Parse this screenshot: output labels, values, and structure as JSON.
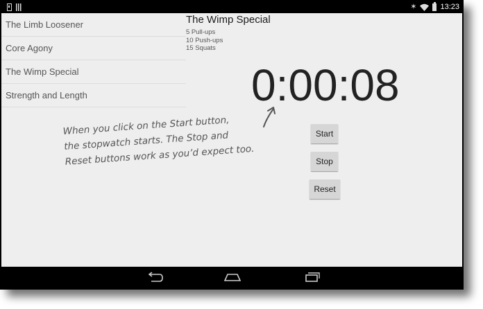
{
  "status_bar": {
    "left_icons": [
      "phone-icon",
      "signal-bars-icon"
    ],
    "right_icons": [
      "bluetooth-icon",
      "wifi-icon",
      "battery-icon"
    ],
    "time": "13:23"
  },
  "workouts": [
    {
      "label": "The Limb Loosener"
    },
    {
      "label": "Core Agony"
    },
    {
      "label": "The Wimp Special"
    },
    {
      "label": "Strength and Length"
    }
  ],
  "detail": {
    "title": "The Wimp Special",
    "description": [
      "5 Pull-ups",
      "10 Push-ups",
      "15 Squats"
    ]
  },
  "stopwatch": {
    "time": "0:00:08",
    "start_label": "Start",
    "stop_label": "Stop",
    "reset_label": "Reset"
  },
  "annotation": {
    "lines": [
      "When you click on the Start button,",
      "the stopwatch starts. The Stop and",
      "Reset buttons work as you’d expect too."
    ]
  },
  "nav_bar": {
    "icons": [
      "back-icon",
      "home-icon",
      "recent-apps-icon"
    ]
  }
}
